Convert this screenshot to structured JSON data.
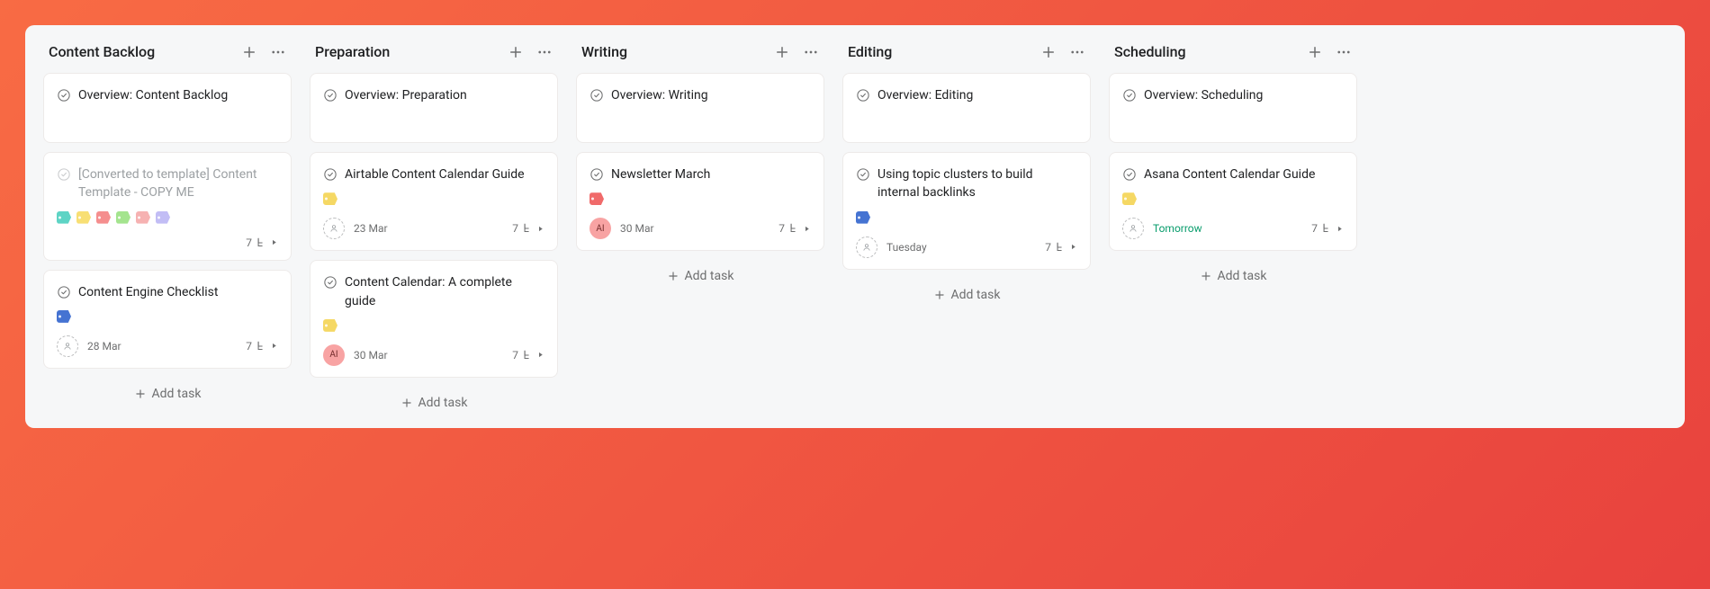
{
  "add_task_label": "Add task",
  "columns": [
    {
      "title": "Content Backlog",
      "cards": [
        {
          "type": "overview",
          "title": "Overview: Content Backlog"
        },
        {
          "type": "task",
          "muted": true,
          "title": "[Converted to template] Content Template - COPY ME",
          "tags": [
            "teal",
            "yellow",
            "pink",
            "green",
            "blush",
            "lilac"
          ],
          "footer": {
            "only_right": true,
            "subtasks": 7,
            "sub_icon": true,
            "chevron": true
          }
        },
        {
          "type": "task",
          "title": "Content Engine Checklist",
          "tags": [
            "blue"
          ],
          "footer": {
            "avatar": "dashed",
            "date": "28 Mar",
            "subtasks": 7,
            "sub_icon": true,
            "chevron": true
          }
        }
      ]
    },
    {
      "title": "Preparation",
      "cards": [
        {
          "type": "overview",
          "title": "Overview: Preparation"
        },
        {
          "type": "task",
          "title": "Airtable Content Calendar Guide",
          "tags": [
            "gold"
          ],
          "footer": {
            "avatar": "dashed",
            "date": "23 Mar",
            "subtasks": 7,
            "sub_icon": true,
            "chevron": true
          }
        },
        {
          "type": "task",
          "title": "Content Calendar: A complete guide",
          "tags": [
            "gold"
          ],
          "footer": {
            "avatar": "pink",
            "avatar_text": "AI",
            "date": "30 Mar",
            "subtasks": 7,
            "sub_icon": true,
            "chevron": true
          }
        }
      ]
    },
    {
      "title": "Writing",
      "cards": [
        {
          "type": "overview",
          "title": "Overview: Writing"
        },
        {
          "type": "task",
          "title": "Newsletter March",
          "tags": [
            "red"
          ],
          "footer": {
            "avatar": "pink",
            "avatar_text": "AI",
            "date": "30 Mar",
            "subtasks": 7,
            "sub_icon": true,
            "chevron": true
          }
        }
      ]
    },
    {
      "title": "Editing",
      "cards": [
        {
          "type": "overview",
          "title": "Overview: Editing"
        },
        {
          "type": "task",
          "title": "Using topic clusters to build internal backlinks",
          "tags": [
            "blue"
          ],
          "footer": {
            "avatar": "dashed",
            "date": "Tuesday",
            "subtasks": 7,
            "sub_icon": true,
            "chevron": true
          }
        }
      ]
    },
    {
      "title": "Scheduling",
      "cards": [
        {
          "type": "overview",
          "title": "Overview: Scheduling"
        },
        {
          "type": "task",
          "title": "Asana Content Calendar Guide",
          "tags": [
            "gold"
          ],
          "footer": {
            "avatar": "dashed",
            "date": "Tomorrow",
            "date_color": "green",
            "subtasks": 7,
            "sub_icon": true,
            "chevron": true
          }
        }
      ]
    }
  ]
}
